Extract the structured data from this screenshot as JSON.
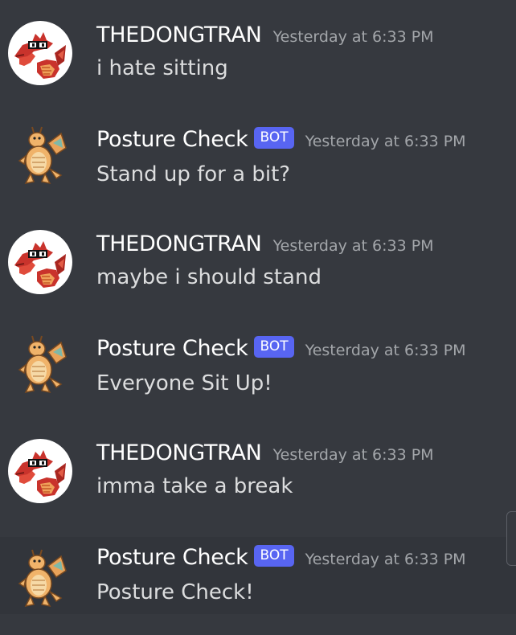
{
  "messages": [
    {
      "author": "THEDONGTRAN",
      "is_bot": false,
      "timestamp": "Yesterday at 6:33 PM",
      "text": "i hate sitting",
      "avatar": "red-dragon-glasses-avatar"
    },
    {
      "author": "Posture Check",
      "is_bot": true,
      "bot_tag": "BOT",
      "timestamp": "Yesterday at 6:33 PM",
      "text": "Stand up for a bit?",
      "avatar": "dragonite-avatar"
    },
    {
      "author": "THEDONGTRAN",
      "is_bot": false,
      "timestamp": "Yesterday at 6:33 PM",
      "text": "maybe i should stand",
      "avatar": "red-dragon-glasses-avatar"
    },
    {
      "author": "Posture Check",
      "is_bot": true,
      "bot_tag": "BOT",
      "timestamp": "Yesterday at 6:33 PM",
      "text": "Everyone Sit Up!",
      "avatar": "dragonite-avatar"
    },
    {
      "author": "THEDONGTRAN",
      "is_bot": false,
      "timestamp": "Yesterday at 6:33 PM",
      "text": "imma take a break",
      "avatar": "red-dragon-glasses-avatar"
    },
    {
      "author": "Posture Check",
      "is_bot": true,
      "bot_tag": "BOT",
      "timestamp": "Yesterday at 6:33 PM",
      "text": "Posture Check!",
      "avatar": "dragonite-avatar"
    }
  ],
  "colors": {
    "background": "#36393f",
    "hover_background": "#32353b",
    "username": "#ffffff",
    "message_text": "#dcddde",
    "timestamp": "#a3a6aa",
    "bot_tag": "#5865f2"
  }
}
